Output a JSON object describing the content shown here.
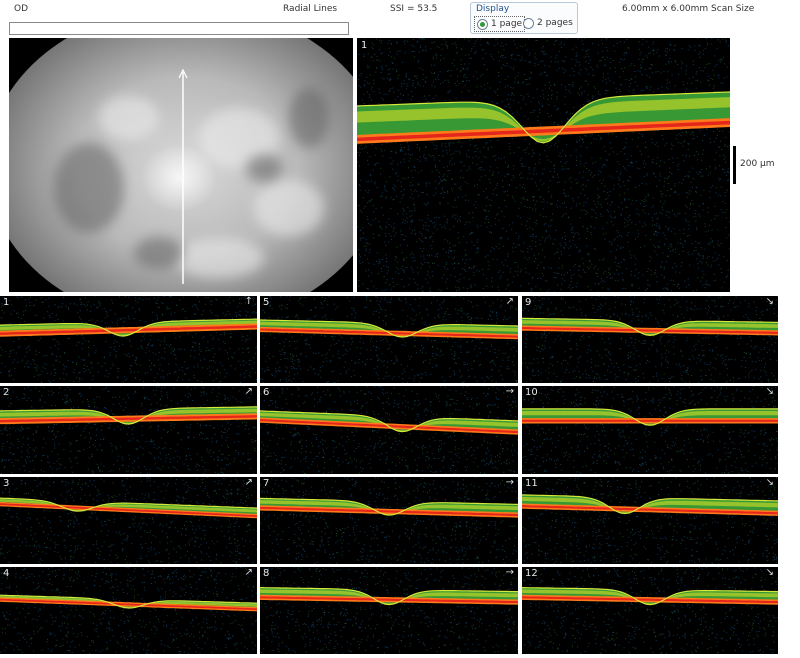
{
  "header": {
    "eye": "OD",
    "scan_pattern": "Radial Lines",
    "ssi": "SSI = 53.5",
    "scan_size": "6.00mm x 6.00mm Scan Size"
  },
  "display": {
    "legend": "Display",
    "options": [
      "1 page",
      "2 pages"
    ],
    "selected": "1 page"
  },
  "main_scan": {
    "number": "1",
    "scale_label": "200 µm"
  },
  "thumbnails": [
    {
      "number": "1",
      "dir": "↑"
    },
    {
      "number": "2",
      "dir": "↗"
    },
    {
      "number": "3",
      "dir": "↗"
    },
    {
      "number": "4",
      "dir": "↗"
    },
    {
      "number": "5",
      "dir": "↗"
    },
    {
      "number": "6",
      "dir": "→"
    },
    {
      "number": "7",
      "dir": "→"
    },
    {
      "number": "8",
      "dir": "→"
    },
    {
      "number": "9",
      "dir": "↘"
    },
    {
      "number": "10",
      "dir": "↘"
    },
    {
      "number": "11",
      "dir": "↘"
    },
    {
      "number": "12",
      "dir": "↘"
    }
  ]
}
